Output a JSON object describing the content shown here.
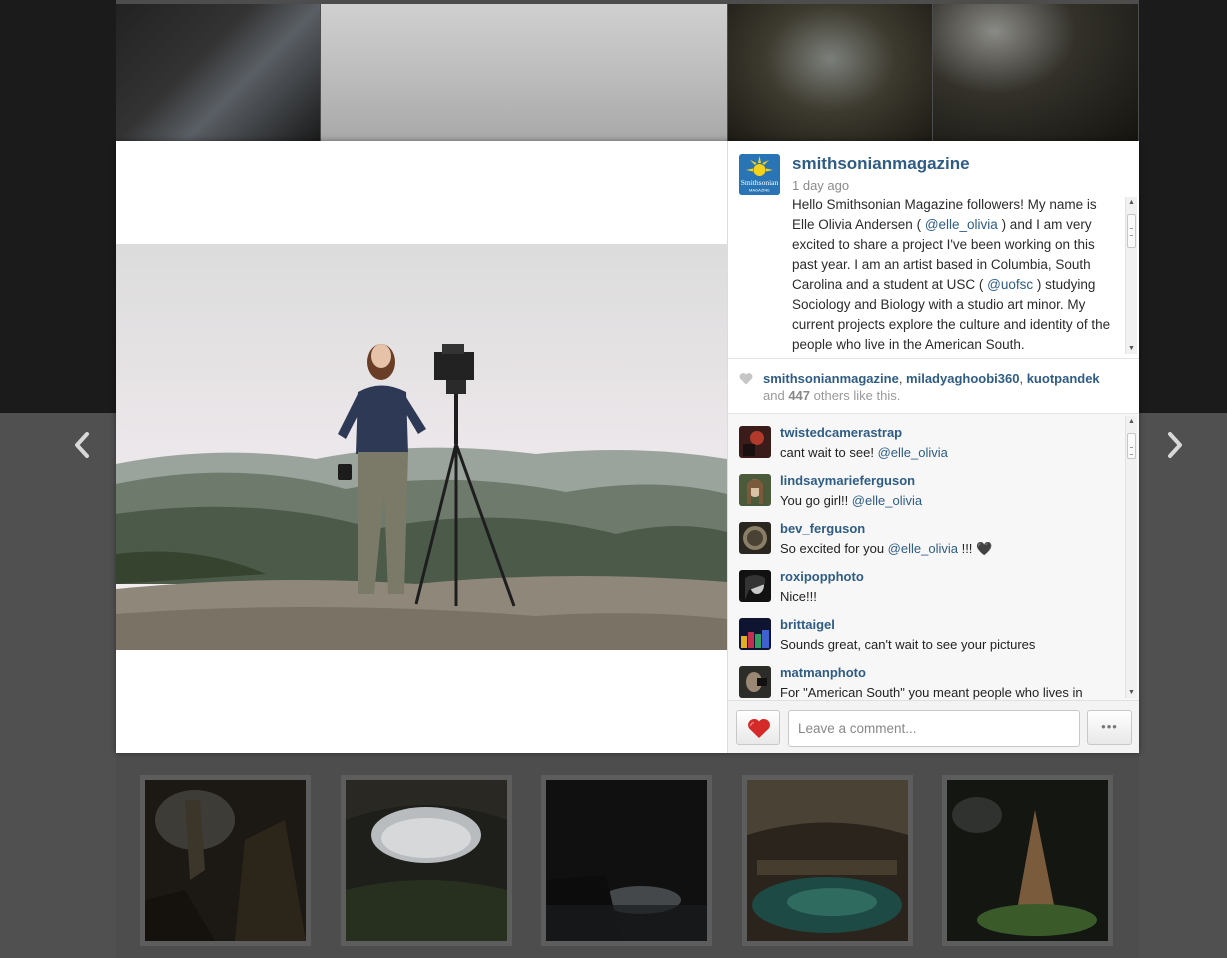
{
  "post": {
    "username": "smithsonianmagazine",
    "avatar_text": "Smithsonian",
    "avatar_subtext": "MAGAZINE",
    "time_ago": "1 day ago",
    "caption": {
      "part1": "Hello Smithsonian Magazine followers! My name is Elle Olivia Andersen ( ",
      "mention1": "@elle_olivia",
      "part2": " ) and I am very excited to share a project I've been working on this past year. I am an artist based in Columbia, South Carolina and a student at USC ( ",
      "mention2": "@uofsc",
      "part3": " ) studying Sociology and Biology with a studio art minor. My current projects explore the culture and identity of the people who live in the American South."
    }
  },
  "likes": {
    "likers": [
      "smithsonianmagazine",
      "miladyaghoobi360",
      "kuotpandek"
    ],
    "separator": ", ",
    "prefix": "and ",
    "count": "447",
    "suffix": " others like this."
  },
  "comments": [
    {
      "user": "twistedcamerastrap",
      "text": "cant wait to see! ",
      "mention": "@elle_olivia",
      "after": ""
    },
    {
      "user": "lindsaymarieferguson",
      "text": "You go girl!! ",
      "mention": "@elle_olivia",
      "after": ""
    },
    {
      "user": "bev_ferguson",
      "text": "So excited for you ",
      "mention": "@elle_olivia",
      "after": " !!! 🖤"
    },
    {
      "user": "roxipopphoto",
      "text": "Nice!!!",
      "mention": "",
      "after": ""
    },
    {
      "user": "brittaigel",
      "text": "Sounds great, can't wait to see your pictures",
      "mention": "",
      "after": ""
    },
    {
      "user": "matmanphoto",
      "text": "For \"American South\" you meant people who lives in",
      "mention": "",
      "after": ""
    }
  ],
  "comment_bar": {
    "placeholder": "Leave a comment...",
    "more_label": "•••"
  },
  "icons": {
    "prev": "chevron-left-icon",
    "next": "chevron-right-icon",
    "like": "heart-icon",
    "likes_indicator": "heart-icon"
  },
  "colors": {
    "link": "#2f5c85",
    "like_red": "#d52a2a",
    "muted": "#8a8a8a"
  }
}
